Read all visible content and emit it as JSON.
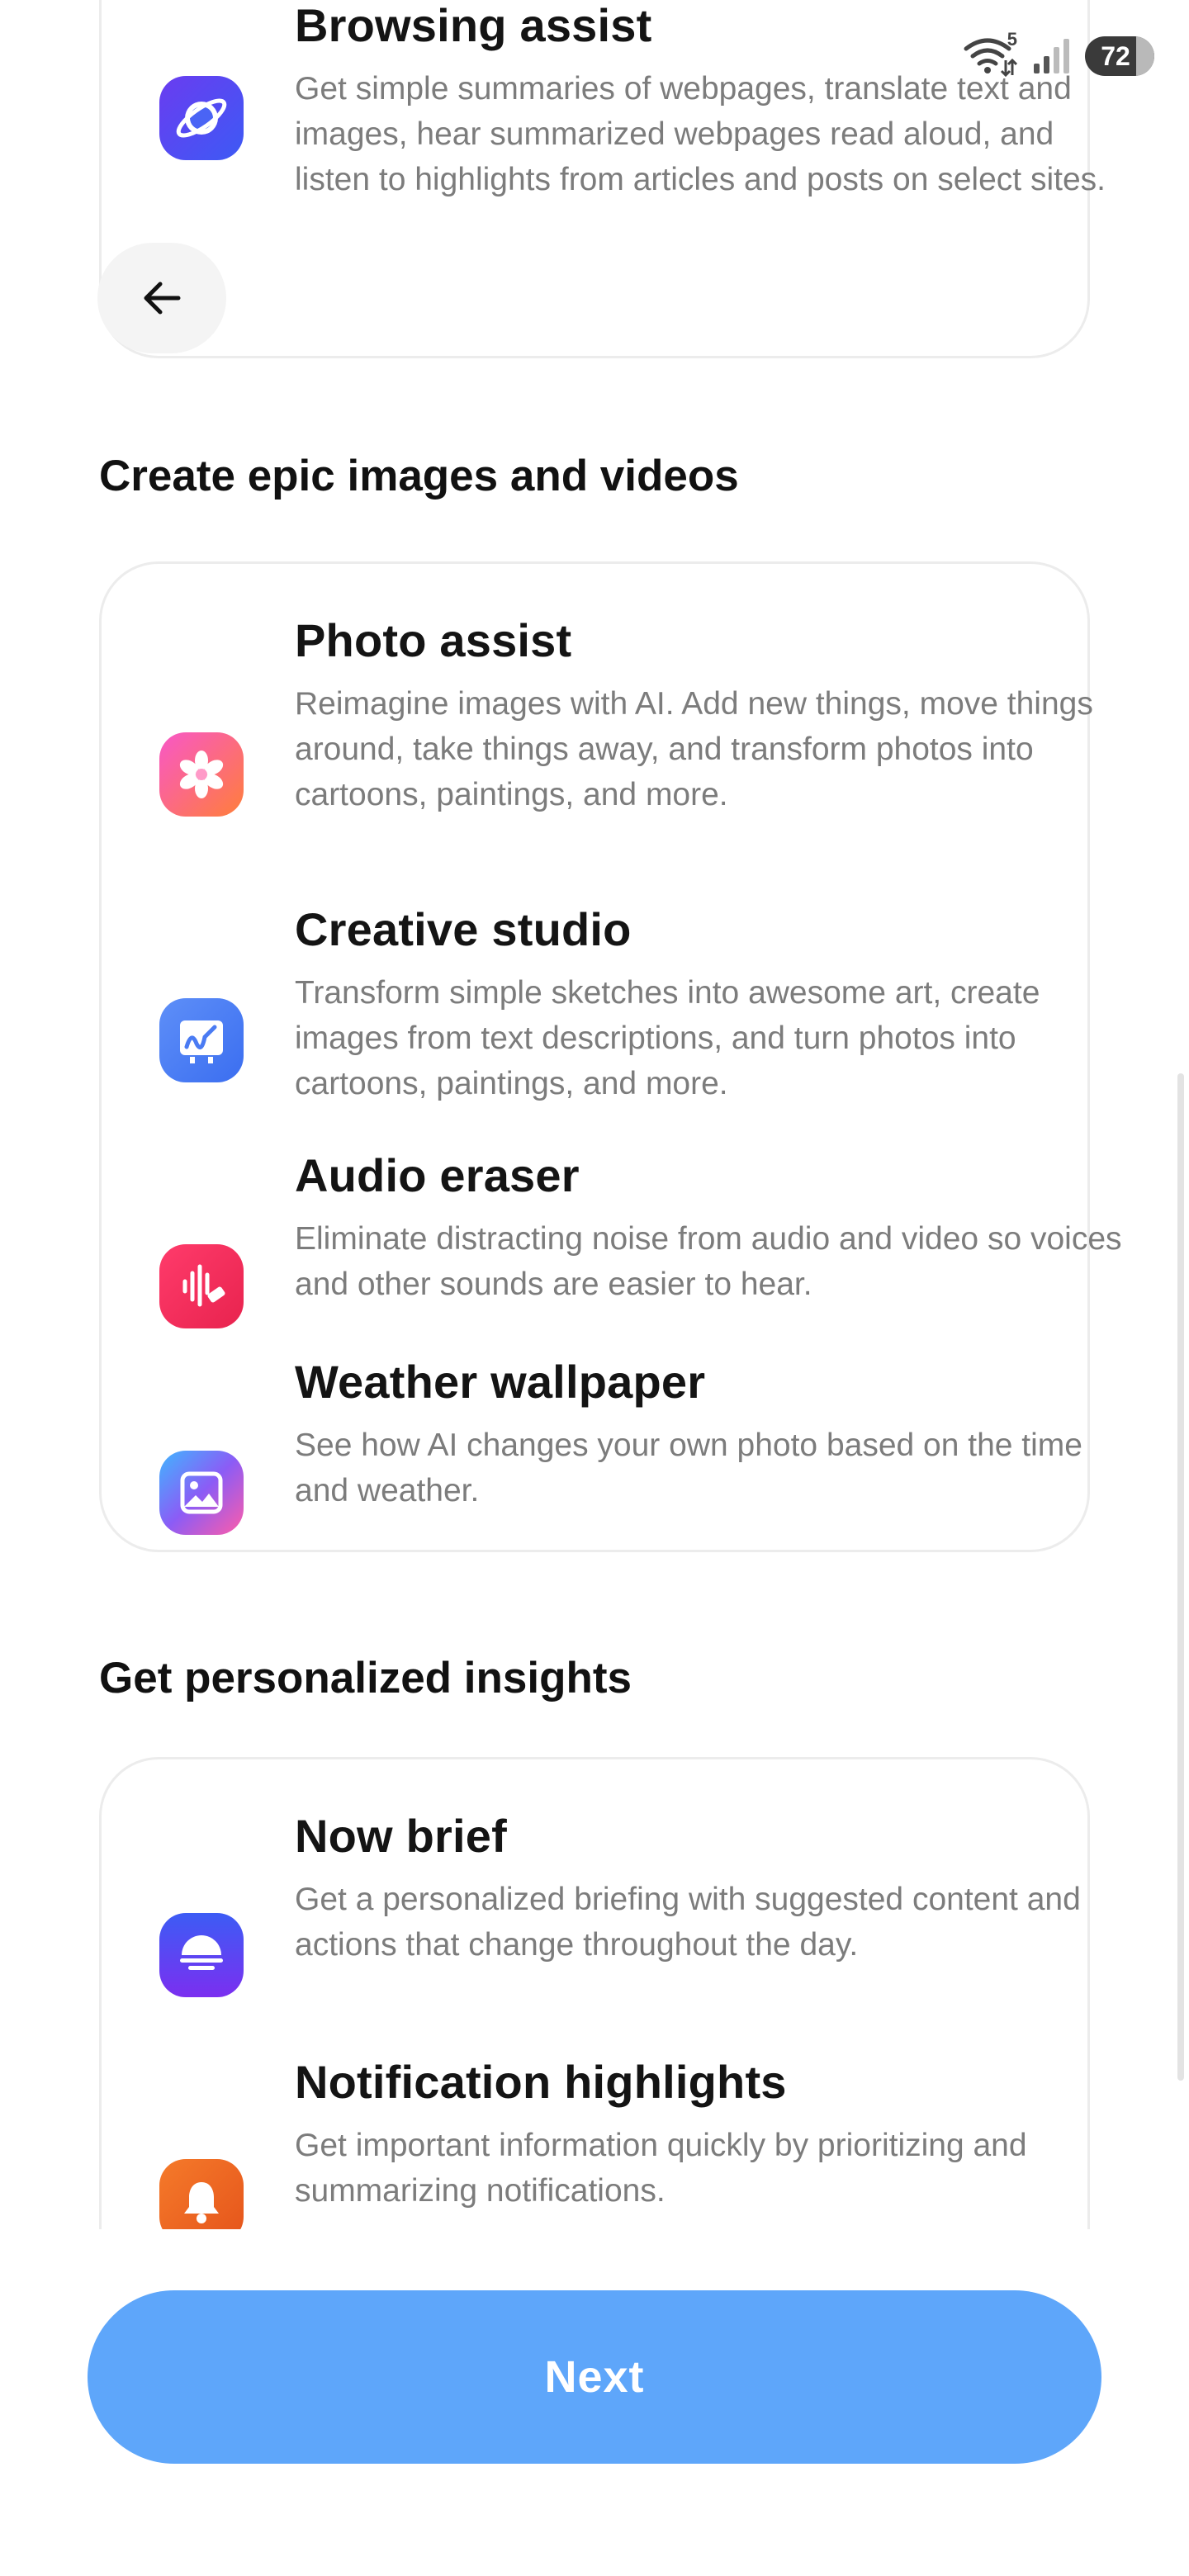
{
  "status_bar": {
    "wifi_badge": "5",
    "battery_level": "72"
  },
  "top_card": {
    "title": "Browsing assist",
    "description": "Get simple summaries of webpages, translate text and images, hear summarized webpages read aloud, and listen to highlights from articles and posts on select sites."
  },
  "create_section": {
    "heading": "Create epic images and videos",
    "features": [
      {
        "title": "Photo assist",
        "description": "Reimagine images with AI. Add new things, move things around, take things away, and transform photos into cartoons, paintings, and more.",
        "icon": "photo-gallery-icon",
        "color": "#ec4fa1"
      },
      {
        "title": "Creative studio",
        "description": "Transform simple sketches into awesome art, create images from text descriptions, and turn photos into cartoons, paintings, and more.",
        "icon": "creative-studio-icon",
        "color": "#4f8ff7"
      },
      {
        "title": "Audio eraser",
        "description": "Eliminate distracting noise from audio and video so voices and other sounds are easier to hear.",
        "icon": "audio-eraser-icon",
        "color": "#f0315a"
      },
      {
        "title": "Weather wallpaper",
        "description": "See how AI changes your own photo based on the time and weather.",
        "icon": "weather-wallpaper-icon",
        "color": "#8b5cf6"
      }
    ]
  },
  "insights_section": {
    "heading": "Get personalized insights",
    "features": [
      {
        "title": "Now brief",
        "description": "Get a personalized briefing with suggested content and actions that change throughout the day.",
        "icon": "now-brief-icon",
        "color": "#5b3df0"
      },
      {
        "title": "Notification highlights",
        "description": "Get important information quickly by prioritizing and summarizing notifications.",
        "icon": "notification-bell-icon",
        "color": "#f06423"
      }
    ]
  },
  "footer": {
    "next_label": "Next",
    "accent": "#5ea6fa"
  }
}
